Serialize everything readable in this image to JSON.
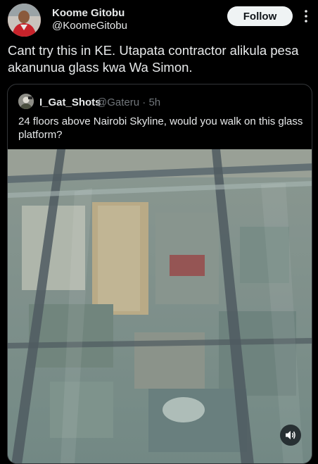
{
  "post": {
    "author": {
      "name": "Koome Gitobu",
      "handle": "@KoomeGitobu"
    },
    "follow_label": "Follow",
    "text": "Cant try this in KE. Utapata contractor alikula pesa akanunua glass kwa Wa Simon."
  },
  "quote": {
    "author": {
      "name": "I_Gat_Shots",
      "handle": "@Gateru",
      "time": "5h"
    },
    "text": "24 floors above Nairobi Skyline, would you walk on this glass platform?"
  },
  "icons": {
    "more": "more-dots-icon",
    "volume": "volume-icon"
  },
  "colors": {
    "background": "#000000",
    "text_primary": "#e7e9ea",
    "text_secondary": "#71767b",
    "follow_button_bg": "#eff3f4",
    "card_border": "#333639"
  }
}
